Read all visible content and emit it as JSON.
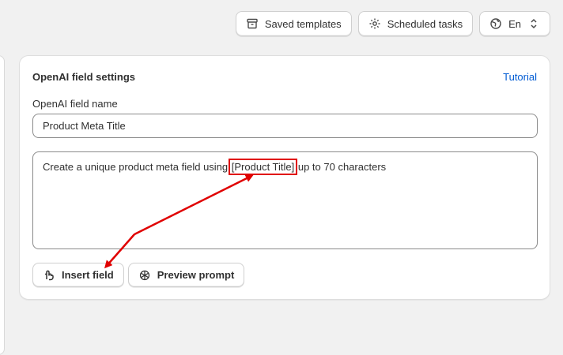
{
  "topbar": {
    "saved_templates": "Saved templates",
    "scheduled_tasks": "Scheduled tasks",
    "language": "En"
  },
  "card": {
    "title": "OpenAI field settings",
    "tutorial": "Tutorial",
    "field_name_label": "OpenAI field name",
    "field_name_value": "Product Meta Title",
    "prompt_before": "Create a unique product meta field using ",
    "prompt_token": "[Product Title]",
    "prompt_after": " up to 70 characters",
    "insert_field": "Insert field",
    "preview_prompt": "Preview prompt"
  },
  "colors": {
    "accent_link": "#005bd3",
    "annotation_red": "#e00000"
  },
  "icons": [
    "archive-icon",
    "gear-icon",
    "globe-icon",
    "chevron-up-down-icon",
    "insert-field-icon",
    "openai-icon"
  ]
}
